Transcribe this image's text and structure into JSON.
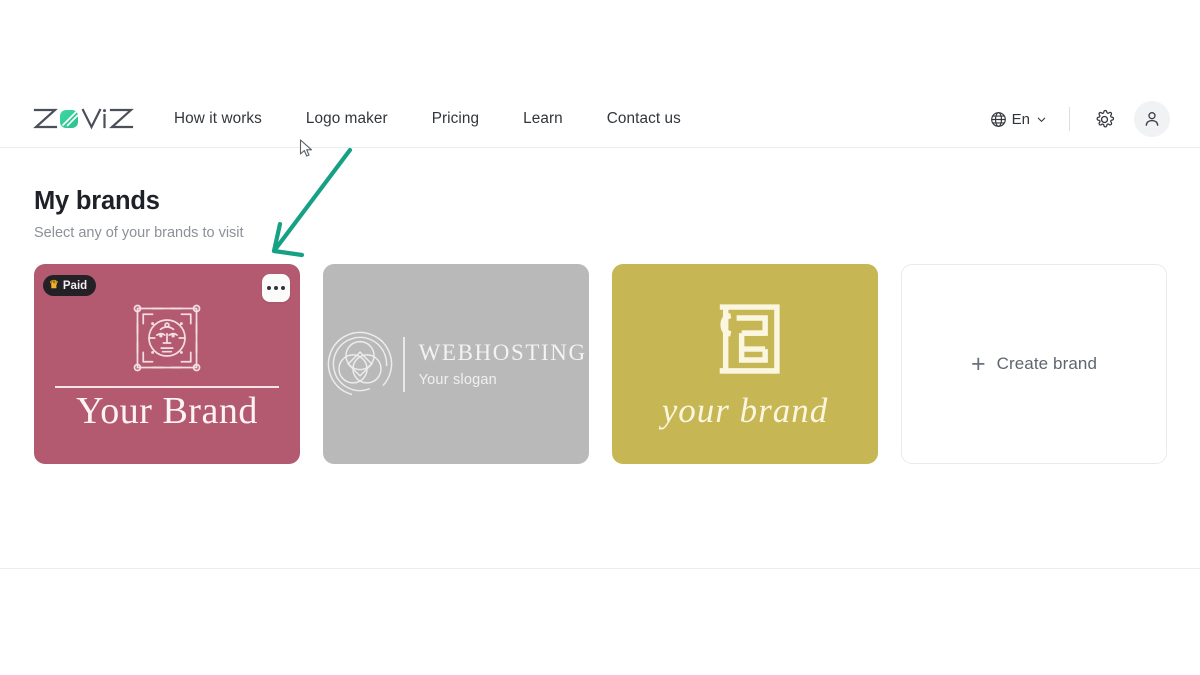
{
  "header": {
    "logo_text": "ZOViZ",
    "nav_items": [
      {
        "label": "How it works"
      },
      {
        "label": "Logo maker"
      },
      {
        "label": "Pricing"
      },
      {
        "label": "Learn"
      },
      {
        "label": "Contact us"
      }
    ],
    "language": {
      "label": "En",
      "icon": "globe-icon",
      "chevron": "chevron-down-icon"
    },
    "settings_icon": "gear-icon",
    "account_icon": "user-avatar-icon"
  },
  "main": {
    "title": "My brands",
    "subtitle": "Select any of your brands to visit",
    "cards": [
      {
        "id": "your-brand",
        "badge": {
          "label": "Paid",
          "icon": "crown-icon"
        },
        "menu": {
          "icon": "ellipsis-icon"
        },
        "logo_mark": "tribal-mask-emblem",
        "name": "Your Brand",
        "bg_color": "#b35a70"
      },
      {
        "id": "webhosting",
        "logo_mark": "interlocking-circles-emblem",
        "name": "WEBHOSTING",
        "slogan": "Your slogan",
        "bg_color": "#b9b9b9"
      },
      {
        "id": "your-brand-olive",
        "logo_mark": "abstract-monogram-emblem",
        "name": "your brand",
        "bg_color": "#c6b654"
      }
    ],
    "create_card": {
      "plus": "+",
      "label": "Create brand"
    }
  },
  "annotations": {
    "arrow": {
      "color": "#16a085",
      "points_to": "brand-card-menu-button"
    },
    "cursor": "mouse-pointer"
  },
  "colors": {
    "accent_green": "#16a085",
    "text_primary": "#1e2127",
    "text_muted": "#8c9099",
    "badge_bg": "#232026",
    "crown_gold": "#f0b323"
  }
}
